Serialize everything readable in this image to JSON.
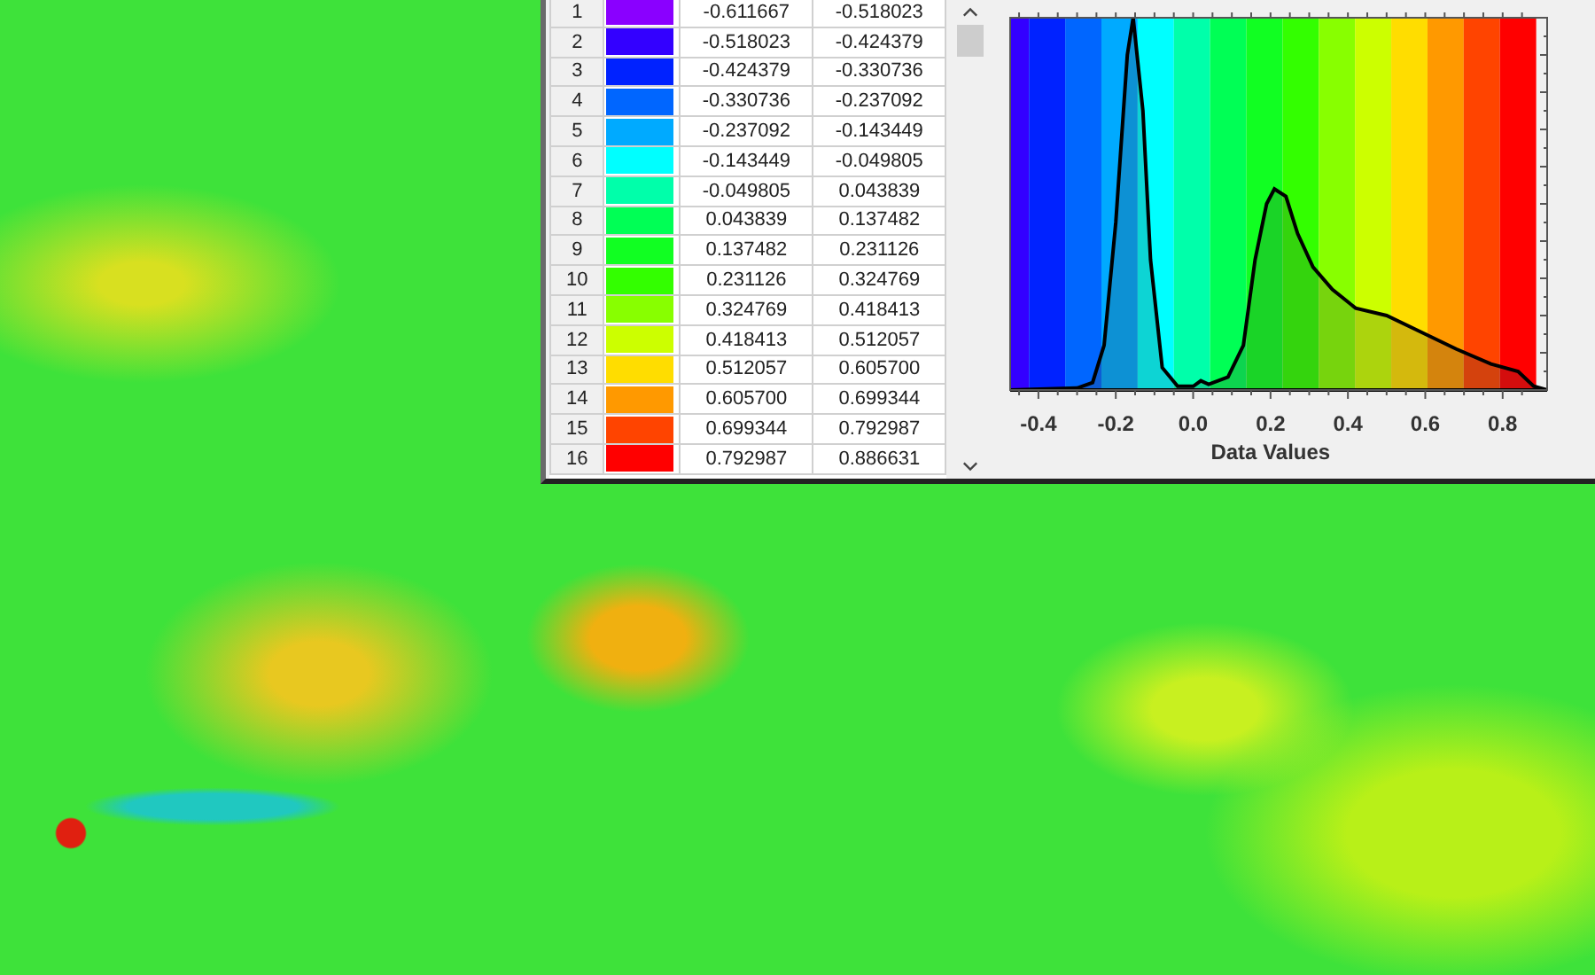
{
  "legend_table": {
    "rows": [
      {
        "index": "1",
        "color": "#8a00ff",
        "from": "-0.611667",
        "to": "-0.518023"
      },
      {
        "index": "2",
        "color": "#3300ff",
        "from": "-0.518023",
        "to": "-0.424379"
      },
      {
        "index": "3",
        "color": "#0022ff",
        "from": "-0.424379",
        "to": "-0.330736"
      },
      {
        "index": "4",
        "color": "#0066ff",
        "from": "-0.330736",
        "to": "-0.237092"
      },
      {
        "index": "5",
        "color": "#00aaff",
        "from": "-0.237092",
        "to": "-0.143449"
      },
      {
        "index": "6",
        "color": "#00ffff",
        "from": "-0.143449",
        "to": "-0.049805"
      },
      {
        "index": "7",
        "color": "#00ffaa",
        "from": "-0.049805",
        "to": "0.043839"
      },
      {
        "index": "8",
        "color": "#00ff55",
        "from": "0.043839",
        "to": "0.137482"
      },
      {
        "index": "9",
        "color": "#11ff22",
        "from": "0.137482",
        "to": "0.231126"
      },
      {
        "index": "10",
        "color": "#33ff00",
        "from": "0.231126",
        "to": "0.324769"
      },
      {
        "index": "11",
        "color": "#88ff00",
        "from": "0.324769",
        "to": "0.418413"
      },
      {
        "index": "12",
        "color": "#ccff00",
        "from": "0.418413",
        "to": "0.512057"
      },
      {
        "index": "13",
        "color": "#ffdd00",
        "from": "0.512057",
        "to": "0.605700"
      },
      {
        "index": "14",
        "color": "#ff9900",
        "from": "0.605700",
        "to": "0.699344"
      },
      {
        "index": "15",
        "color": "#ff4400",
        "from": "0.699344",
        "to": "0.792987"
      },
      {
        "index": "16",
        "color": "#ff0000",
        "from": "0.792987",
        "to": "0.886631"
      }
    ]
  },
  "histogram": {
    "xlabel": "Data Values",
    "xticks": [
      "-0.4",
      "-0.2",
      "0.0",
      "0.2",
      "0.4",
      "0.6",
      "0.8"
    ]
  }
}
